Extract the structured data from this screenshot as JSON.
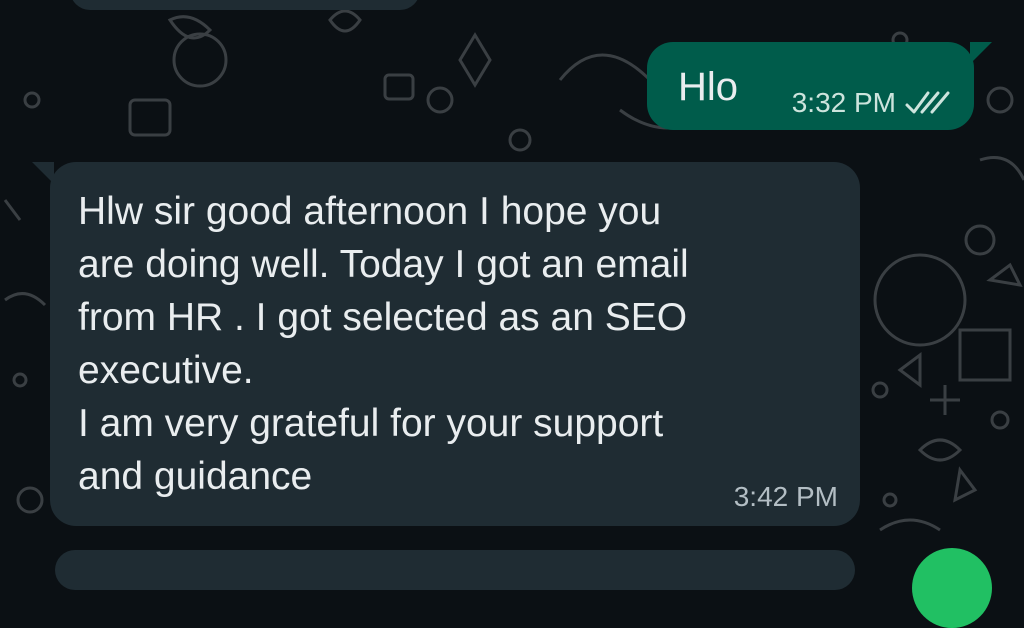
{
  "messages": [
    {
      "direction": "outgoing",
      "text": "Hlo",
      "time": "3:32 PM",
      "status_icon": "double-check-icon"
    },
    {
      "direction": "incoming",
      "text": "Hlw sir good afternoon I hope you\nare doing well. Today I got an email\nfrom HR . I got selected as an SEO\nexecutive.\nI am very grateful for your support\nand guidance",
      "time": "3:42 PM"
    }
  ],
  "colors": {
    "background": "#0b1014",
    "incoming_bubble": "#1f2c33",
    "outgoing_bubble": "#005c4b",
    "text": "#e9edef",
    "fab": "#21c063"
  }
}
